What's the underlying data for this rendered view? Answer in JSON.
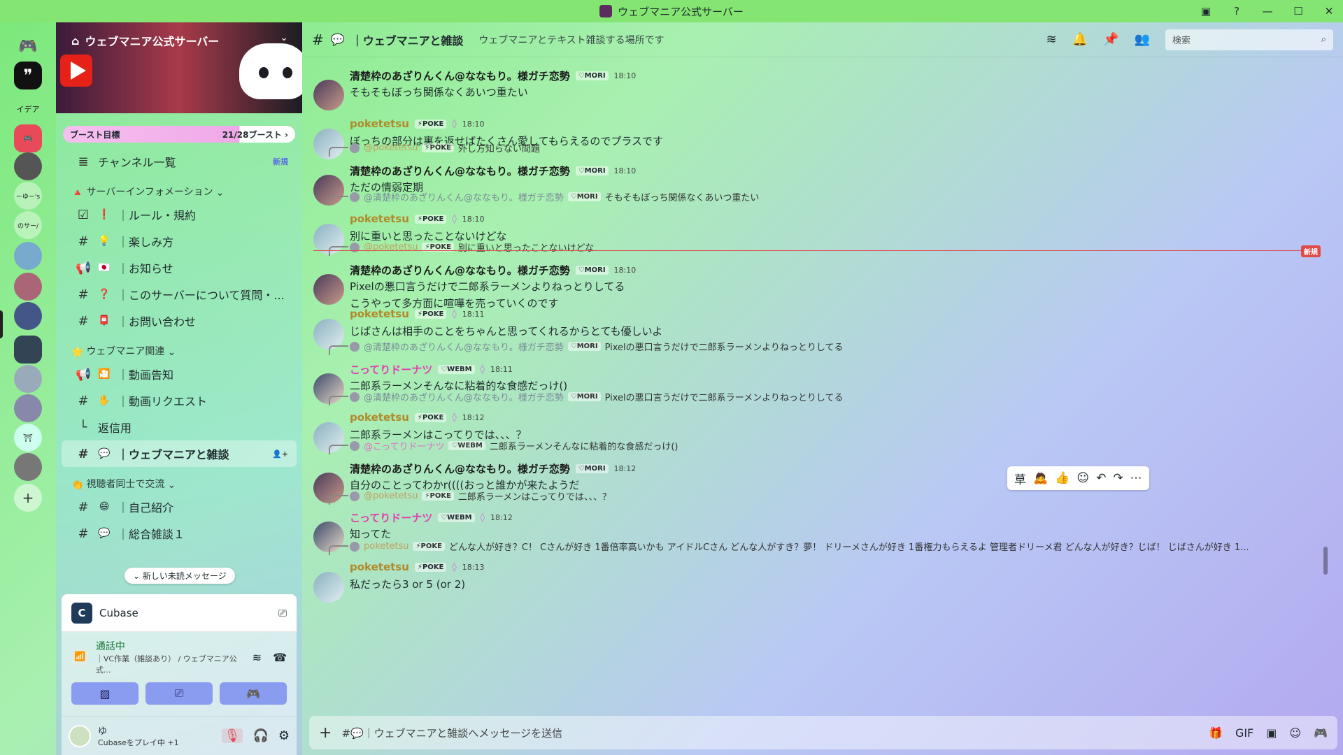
{
  "window": {
    "title": "ウェブマニア公式サーバー"
  },
  "rail": {
    "items": [
      {
        "name": "home",
        "label": ""
      },
      {
        "name": "quote-server",
        "label": "99"
      },
      {
        "name": "idea",
        "label": "イデア"
      },
      {
        "name": "discord-red",
        "label": ""
      },
      {
        "name": "server-5",
        "label": ""
      },
      {
        "name": "server-6",
        "label": "ーゆー's"
      },
      {
        "name": "server-7",
        "label": "のサー/"
      }
    ]
  },
  "sidebar": {
    "server_name": "ウェブマニア公式サーバー",
    "boost": {
      "label": "ブースト目標",
      "count": "21/28ブースト ›",
      "progress": 0.75
    },
    "channel_list": {
      "label": "チャンネル一覧",
      "badge": "新規"
    },
    "categories": [
      {
        "name": "サーバーインフォメーション",
        "emoji": "🔺",
        "channels": [
          {
            "icon": "☑",
            "emoji": "❗",
            "name": "｜ルール・規約"
          },
          {
            "icon": "#",
            "emoji": "💡",
            "name": "｜楽しみ方"
          },
          {
            "icon": "📢",
            "emoji": "🇯🇵",
            "name": "｜お知らせ"
          },
          {
            "icon": "#",
            "emoji": "❓",
            "name": "｜このサーバーについて質問・..."
          },
          {
            "icon": "#",
            "emoji": "📮",
            "name": "｜お問い合わせ"
          }
        ]
      },
      {
        "name": "ウェブマニア関連",
        "emoji": "🌟",
        "channels": [
          {
            "icon": "📢",
            "emoji": "🎦",
            "name": "｜動画告知"
          },
          {
            "icon": "#",
            "emoji": "✋",
            "name": "｜動画リクエスト"
          },
          {
            "icon": "└",
            "emoji": "",
            "name": "返信用"
          },
          {
            "icon": "#",
            "emoji": "💬",
            "name": "｜ウェブマニアと雑談",
            "active": true
          }
        ]
      },
      {
        "name": "視聴者同士で交流",
        "emoji": "👏",
        "channels": [
          {
            "icon": "#",
            "emoji": "😄",
            "name": "｜自己紹介"
          },
          {
            "icon": "#",
            "emoji": "💬",
            "name": "｜総合雑談１"
          }
        ]
      }
    ],
    "unread_pill": "新しい未読メッセージ",
    "activity": {
      "app": "Cubase"
    },
    "voice": {
      "status": "通話中",
      "channel": "｜VC作業（雑談あり） / ウェブマニア公式..."
    },
    "user": {
      "name": "ゆ",
      "status": "Cubaseをプレイ中 +1"
    }
  },
  "header": {
    "channel": "｜ウェブマニアと雑談",
    "topic": "ウェブマニアとテキスト雑談する場所です",
    "search_placeholder": "検索"
  },
  "messages": [
    {
      "author": "清楚枠のあざりんくん@ななもり。様ガチ恋勢",
      "type": "mori",
      "tag": "MORI",
      "time": "18:10",
      "lines": [
        "そもそもぼっち関係なくあいつ重たい"
      ],
      "reply": null
    },
    {
      "author": "poketetsu",
      "type": "poke",
      "tag": "POKE",
      "time": "18:10",
      "lines": [
        "ぼっちの部分は裏を返せばたくさん愛してもらえるのでプラスです"
      ],
      "reply": null
    },
    {
      "author": "清楚枠のあざりんくん@ななもり。様ガチ恋勢",
      "type": "mori",
      "tag": "MORI",
      "time": "18:10",
      "lines": [
        "ただの情弱定期"
      ],
      "reply": {
        "user": "@poketetsu",
        "tag": "POKE",
        "text": "外し方知らない問題"
      }
    },
    {
      "author": "poketetsu",
      "type": "poke",
      "tag": "POKE",
      "time": "18:10",
      "lines": [
        "別に重いと思ったことないけどな"
      ],
      "reply": {
        "user": "@清楚枠のあざりんくん@ななもり。様ガチ恋勢",
        "tag": "MORI",
        "text": "そもそもぼっち関係なくあいつ重たい"
      }
    },
    {
      "author": "清楚枠のあざりんくん@ななもり。様ガチ恋勢",
      "type": "mori",
      "tag": "MORI",
      "time": "18:10",
      "lines": [
        "Pixelの悪口言うだけで二郎系ラーメンよりねっとりしてる",
        "こうやって多方面に喧嘩を売っていくのです"
      ],
      "reply": {
        "user": "@poketetsu",
        "tag": "POKE",
        "text": "別に重いと思ったことないけどな"
      }
    },
    {
      "author": "poketetsu",
      "type": "poke",
      "tag": "POKE",
      "time": "18:11",
      "lines": [
        "じばさんは相手のことをちゃんと思ってくれるからとても優しいよ"
      ],
      "reply": null
    },
    {
      "author": "こってりドーナツ",
      "type": "don",
      "tag": "WEBM",
      "time": "18:11",
      "lines": [
        "二郎系ラーメンそんなに粘着的な食感だっけ()"
      ],
      "reply": {
        "user": "@清楚枠のあざりんくん@ななもり。様ガチ恋勢",
        "tag": "MORI",
        "text": "Pixelの悪口言うだけで二郎系ラーメンよりねっとりしてる"
      }
    },
    {
      "author": "poketetsu",
      "type": "poke",
      "tag": "POKE",
      "time": "18:12",
      "lines": [
        "二郎系ラーメンはこってりでは、、、？"
      ],
      "reply": {
        "user": "@清楚枠のあざりんくん@ななもり。様ガチ恋勢",
        "tag": "MORI",
        "text": "Pixelの悪口言うだけで二郎系ラーメンよりねっとりしてる"
      }
    },
    {
      "author": "清楚枠のあざりんくん@ななもり。様ガチ恋勢",
      "type": "mori",
      "tag": "MORI",
      "time": "18:12",
      "lines": [
        "自分のことってわかr((((おっと誰かが来たようだ"
      ],
      "reply": {
        "user": "@こってりドーナツ",
        "tag": "WEBM",
        "text": "二郎系ラーメンそんなに粘着的な食感だっけ()"
      }
    },
    {
      "author": "こってりドーナツ",
      "type": "don",
      "tag": "WEBM",
      "time": "18:12",
      "lines": [
        "知ってた"
      ],
      "reply": {
        "user": "@poketetsu",
        "tag": "POKE",
        "text": "二郎系ラーメンはこってりでは、、、？"
      }
    },
    {
      "author": "poketetsu",
      "type": "poke",
      "tag": "POKE",
      "time": "18:13",
      "lines": [
        "私だったら3 or 5 (or 2)"
      ],
      "reply": {
        "user": "poketetsu",
        "tag": "POKE",
        "text": "どんな人が好き？C！ Cさんが好き 1番倍率高いかも アイドルCさん どんな人がすき？夢！ ドリーメさんが好き 1番権力もらえるよ 管理者ドリーメ君 どんな人が好き？じば！ じばさんが好き 1..."
      }
    }
  ],
  "new_divider": "新規",
  "composer": {
    "placeholder": "#💬｜ウェブマニアと雑談へメッセージを送信"
  }
}
